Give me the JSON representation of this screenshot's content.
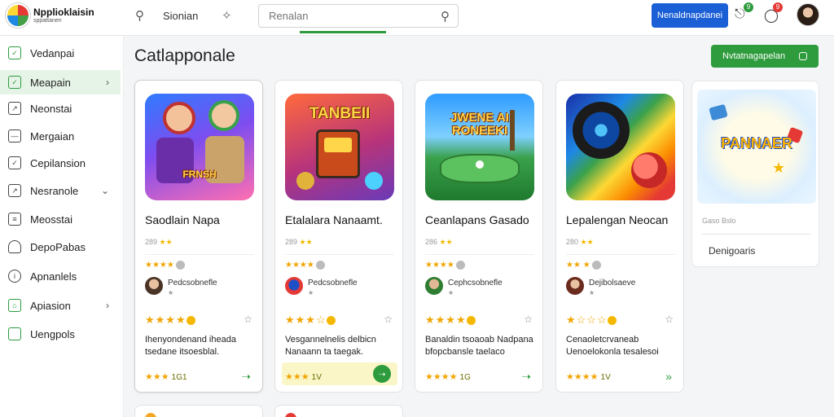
{
  "brand": {
    "name": "Npplioklaisin",
    "subtitle": "sppattanen"
  },
  "topbar": {
    "search_label": "Sionian",
    "search_placeholder": "Renalan",
    "primary_button": "Nenaldnapdanei",
    "notif_badge": "9",
    "alert_badge": "9"
  },
  "sidebar": {
    "items": [
      {
        "label": "Vedanpai",
        "icon": "edit-icon",
        "chevron": false
      },
      {
        "label": "Meapain",
        "icon": "check-icon",
        "chevron": true
      },
      {
        "label": "Neonstai",
        "icon": "trend-icon",
        "chevron": false
      },
      {
        "label": "Mergaian",
        "icon": "box-icon",
        "chevron": false
      },
      {
        "label": "Cepilansion",
        "icon": "check-icon",
        "chevron": false
      },
      {
        "label": "Nesranole",
        "icon": "trend-icon",
        "chevron": true
      },
      {
        "label": "Meosstai",
        "icon": "list-icon",
        "chevron": false
      },
      {
        "label": "DepoPabas",
        "icon": "shield-icon",
        "chevron": false
      },
      {
        "label": "Apnanlels",
        "icon": "info-icon",
        "chevron": false
      },
      {
        "label": "Apiasion",
        "icon": "home-icon",
        "chevron": true
      },
      {
        "label": "Uengpols",
        "icon": "square-icon",
        "chevron": false
      }
    ]
  },
  "main": {
    "title": "Catlapponale",
    "cta_label": "Nvtatnagapelan"
  },
  "cards": [
    {
      "art_text": "FRNSH",
      "title": "Saodlain Napa",
      "meta_num": "289",
      "dev_name": "Pedcsobnefle",
      "dev_sub": "★",
      "desc": "Ihenyondenand iheada tsedane itsoesblal.",
      "score_stars": "★★★",
      "score_val": "1G1"
    },
    {
      "art_text": "TANBEII",
      "title": "Etalalara Nanaamt.",
      "meta_num": "289",
      "dev_name": "Pedcsobnefle",
      "dev_sub": "★",
      "desc": "Vesgannelnelis delbicn Nanaann ta taegak.",
      "score_stars": "★★★",
      "score_val": "1V"
    },
    {
      "art_text": "JWENE AI RONEEKI",
      "title": "Ceanlapans Gasado",
      "meta_num": "286",
      "dev_name": "Cephcsobnefle",
      "dev_sub": "★",
      "desc": "Banaldin tsoaoab Nadpana bfopcbansle taelaco",
      "score_stars": "★★★★",
      "score_val": "1G"
    },
    {
      "art_text": "",
      "title": "Lepalengan Neocan",
      "meta_num": "280",
      "dev_name": "Dejibolsaeve",
      "dev_sub": "★",
      "desc": "Cenaoletcrvaneab Uenoelokonla tesalesoi",
      "score_stars": "★★★★",
      "score_val": "1V"
    }
  ],
  "mini_card": {
    "art_text": "PANNAER",
    "meta": "Gaso Bslo",
    "label": "Denigoaris"
  }
}
